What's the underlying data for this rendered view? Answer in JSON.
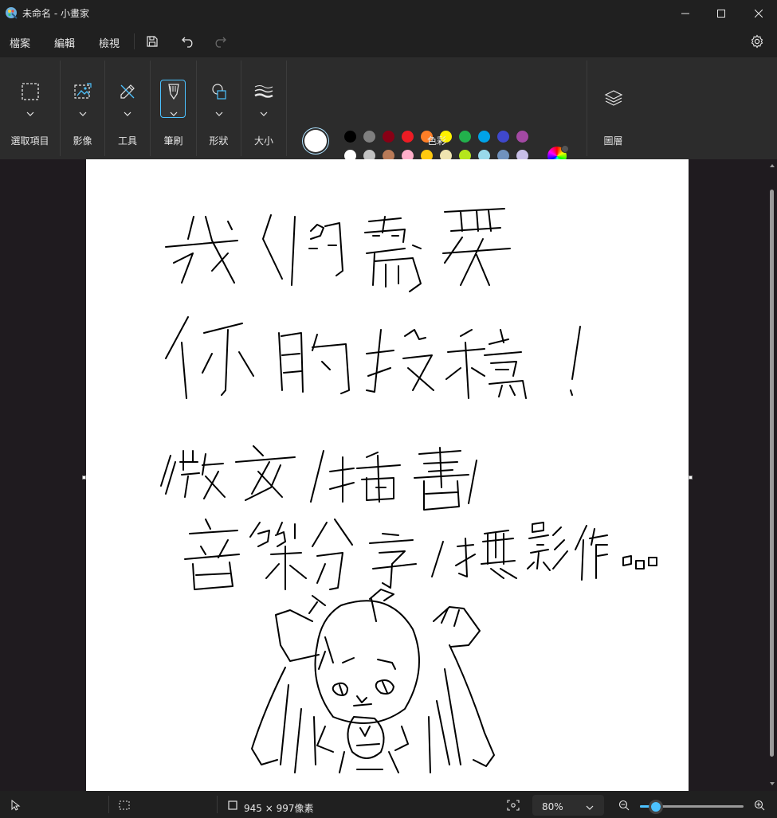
{
  "window": {
    "title": "未命名 - 小畫家",
    "icons": [
      "paint-app-icon",
      "minimize-icon",
      "maximize-icon",
      "close-icon"
    ]
  },
  "menu": {
    "file": "檔案",
    "edit": "編輯",
    "view": "檢視",
    "icons": [
      "save-icon",
      "undo-icon",
      "redo-icon",
      "settings-icon"
    ]
  },
  "ribbon": {
    "selection": "選取項目",
    "image": "影像",
    "tools": "工具",
    "brushes": "筆刷",
    "shapes": "形狀",
    "size": "大小",
    "colors": "色彩",
    "layers": "圖層"
  },
  "colors": {
    "primary": "#ffffff",
    "secondary": "#ffffff",
    "palette_row1": [
      "#000000",
      "#7f7f7f",
      "#880015",
      "#ed1c24",
      "#ff7f27",
      "#fff200",
      "#22b14c",
      "#00a2e8",
      "#3f48cc",
      "#a349a4"
    ],
    "palette_row2": [
      "#ffffff",
      "#c3c3c3",
      "#b97a57",
      "#ffaec9",
      "#ffc90e",
      "#efe4b0",
      "#b5e61d",
      "#99d9ea",
      "#7092be",
      "#c8bfe7"
    ],
    "custom_slots": 10,
    "accent": "#4cc2ff"
  },
  "status": {
    "canvas_size": "945 × 997像素",
    "zoom": "80%",
    "zoom_slider_fraction": 0.15
  }
}
